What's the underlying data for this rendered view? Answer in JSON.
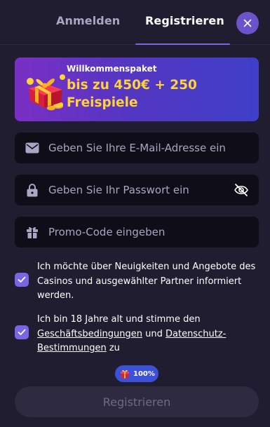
{
  "tabs": {
    "login_label": "Anmelden",
    "register_label": "Registrieren",
    "active": "register"
  },
  "banner": {
    "eyebrow": "Willkommenspaket",
    "headline": "bis zu 450€ + 250 Freispiele",
    "icon": "gift-icon"
  },
  "form": {
    "email": {
      "placeholder": "Geben Sie Ihre E-Mail-Adresse ein",
      "value": "",
      "icon": "mail-icon"
    },
    "password": {
      "placeholder": "Geben Sie Ihr Passwort ein",
      "value": "",
      "icon": "lock-icon",
      "toggle_icon": "eye-off-icon"
    },
    "promo": {
      "placeholder": "Promo-Code eingeben",
      "value": "",
      "icon": "gift-icon"
    }
  },
  "consents": {
    "newsletter": {
      "checked": true,
      "text": "Ich möchte über Neuigkeiten und Angebote des Casinos und ausgewählter Partner informiert werden."
    },
    "terms": {
      "checked": true,
      "text_before": "Ich bin 18 Jahre alt und stimme den ",
      "link_terms": "Geschäftsbedingungen",
      "text_middle": " und ",
      "link_privacy": "Datenschutz-Bestimmungen",
      "text_after": " zu"
    }
  },
  "progress": {
    "label": "100%",
    "value": 1.0
  },
  "submit": {
    "label": "Registrieren",
    "enabled": false
  },
  "colors": {
    "background": "#211d31",
    "accent": "#7a65e6",
    "headline_yellow": "#ffd23a",
    "field_bg": "#0f0d17",
    "badge_blue": "#3d50d8",
    "button_disabled": "#2e2a3f"
  }
}
